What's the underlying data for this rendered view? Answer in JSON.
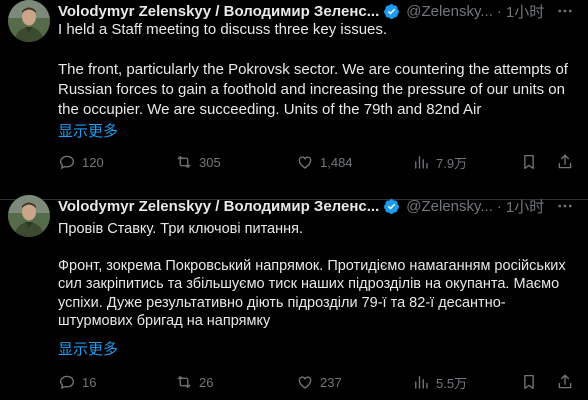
{
  "colors": {
    "background": "#000000",
    "text": "#e7e9ea",
    "muted": "#71767b",
    "link": "#1d9bf0",
    "verified": "#1d9bf0",
    "divider": "#2f3336"
  },
  "tweets": [
    {
      "author_name": "Volodymyr Zelenskyy / Володимир Зеленс...",
      "handle": "@Zelensky...",
      "separator": "·",
      "time": "1小时",
      "paragraphs": [
        "I held a Staff meeting to discuss three key issues.",
        "The front, particularly the Pokrovsk sector. We are countering the attempts of Russian forces to gain a foothold and increasing the pressure of our units on the occupier. We are succeeding. Units of the 79th and 82nd Air"
      ],
      "show_more": "显示更多",
      "replies": "120",
      "retweets": "305",
      "likes": "1,484",
      "views": "7.9万",
      "icons": [
        "verified-badge-icon",
        "more-icon",
        "reply-icon",
        "retweet-icon",
        "like-icon",
        "views-icon",
        "bookmark-icon",
        "share-icon"
      ]
    },
    {
      "author_name": "Volodymyr Zelenskyy / Володимир Зеленс...",
      "handle": "@Zelensky...",
      "separator": "·",
      "time": "1小时",
      "paragraphs": [
        "Провів Ставку. Три ключові питання.",
        "Фронт, зокрема Покровський напрямок. Протидіємо намаганням російських сил закріпитись та збільшуємо тиск наших підрозділів на окупанта. Маємо успіхи. Дуже результативно діють підрозділи 79-ї та 82-ї десантно-штурмових бригад на напрямку"
      ],
      "show_more": "显示更多",
      "replies": "16",
      "retweets": "26",
      "likes": "237",
      "views": "5.5万",
      "icons": [
        "verified-badge-icon",
        "more-icon",
        "reply-icon",
        "retweet-icon",
        "like-icon",
        "views-icon",
        "bookmark-icon",
        "share-icon"
      ]
    }
  ]
}
